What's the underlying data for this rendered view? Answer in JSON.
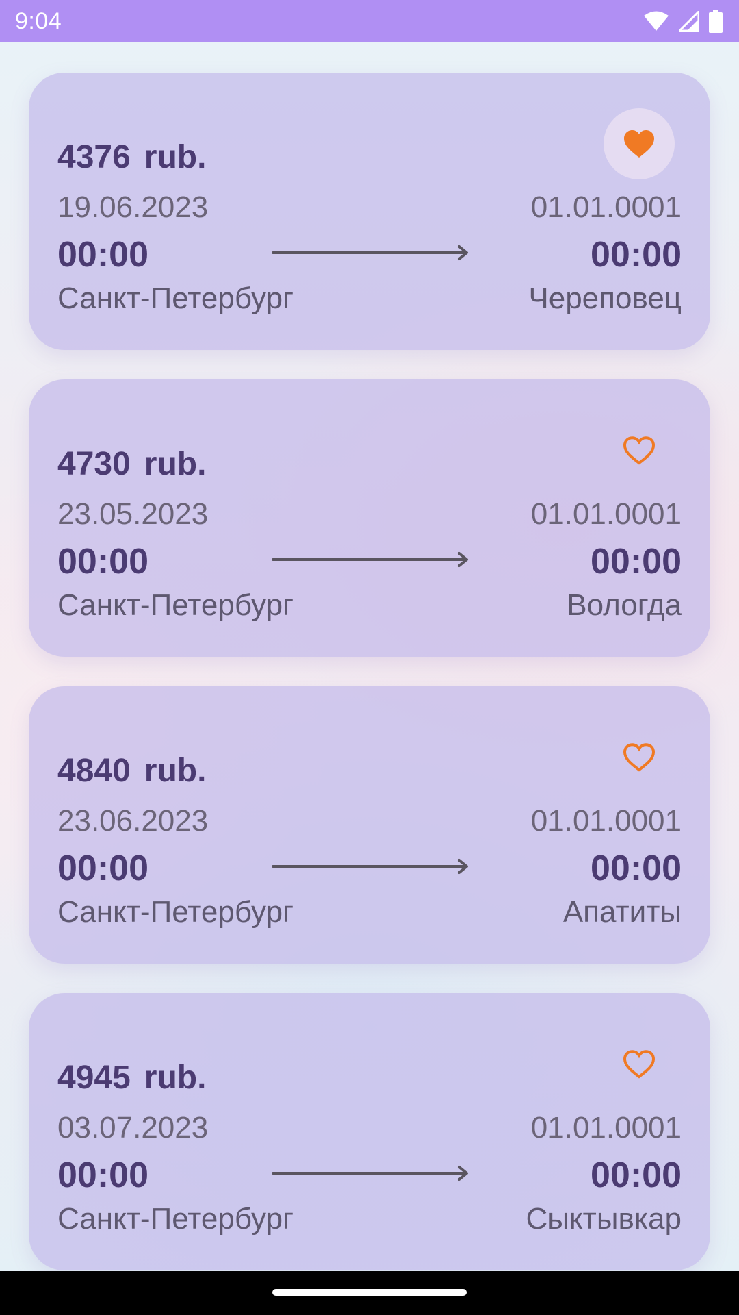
{
  "status_bar": {
    "time": "9:04",
    "color": "#b08ff3",
    "icons": [
      "wifi-icon",
      "signal-icon",
      "battery-icon"
    ]
  },
  "currency_label": "rub.",
  "accent_color": "#f07a24",
  "tickets": [
    {
      "price": "4376",
      "currency": "rub.",
      "favorite": true,
      "departure_date": "19.06.2023",
      "departure_time": "00:00",
      "departure_city": "Санкт-Петербург",
      "arrival_date": "01.01.0001",
      "arrival_time": "00:00",
      "arrival_city": "Череповец"
    },
    {
      "price": "4730",
      "currency": "rub.",
      "favorite": false,
      "departure_date": "23.05.2023",
      "departure_time": "00:00",
      "departure_city": "Санкт-Петербург",
      "arrival_date": "01.01.0001",
      "arrival_time": "00:00",
      "arrival_city": "Вологда"
    },
    {
      "price": "4840",
      "currency": "rub.",
      "favorite": false,
      "departure_date": "23.06.2023",
      "departure_time": "00:00",
      "departure_city": "Санкт-Петербург",
      "arrival_date": "01.01.0001",
      "arrival_time": "00:00",
      "arrival_city": "Апатиты"
    },
    {
      "price": "4945",
      "currency": "rub.",
      "favorite": false,
      "departure_date": "03.07.2023",
      "departure_time": "00:00",
      "departure_city": "Санкт-Петербург",
      "arrival_date": "01.01.0001",
      "arrival_time": "00:00",
      "arrival_city": "Сыктывкар"
    }
  ]
}
